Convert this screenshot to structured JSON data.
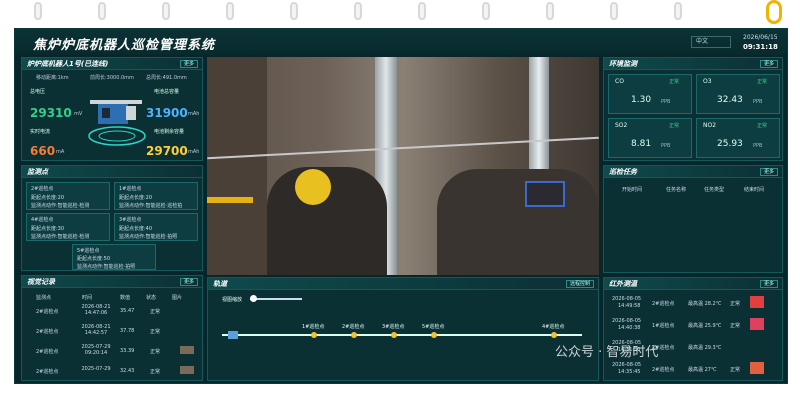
{
  "app": {
    "title": "焦炉炉底机器人巡检管理系统",
    "language": "中文",
    "date": "2026/06/15",
    "time": "09:31:18"
  },
  "robot": {
    "title": "炉炉底机器人1号(已连线)",
    "more": "更多",
    "stats": [
      {
        "label": "移动距离:1km",
        "value": ""
      },
      {
        "label": "前周长:3000.0mm",
        "value": ""
      },
      {
        "label": "总周长:491.0mm",
        "value": ""
      }
    ],
    "voltage_label": "总电压",
    "voltage_value": "29310",
    "voltage_unit": "mV",
    "current_label": "实时电流",
    "current_value": "660",
    "current_unit": "mA",
    "capacity_label": "电池总容量",
    "capacity_value": "31900",
    "capacity_unit": "mAh",
    "remain_label": "电池剩余容量",
    "remain_value": "29700",
    "remain_unit": "mAh"
  },
  "points": {
    "title": "监测点",
    "items": [
      {
        "name": "2#巡检点",
        "line1": "距起点长度:20",
        "line2": "监测点动作:智能巡检·检测"
      },
      {
        "name": "1#巡检点",
        "line1": "距起点长度:20",
        "line2": "监测点动作:智能巡检·巡检拍"
      },
      {
        "name": "4#巡检点",
        "line1": "距起点长度:30",
        "line2": "监测点动作:智能巡检·检测"
      },
      {
        "name": "3#巡检点",
        "line1": "距起点长度:40",
        "line2": "监测点动作:智能巡检·拍照"
      },
      {
        "name": "5#巡检点",
        "line1": "距起点长度:50",
        "line2": "监测点动作:智能巡检·拍照"
      }
    ]
  },
  "report": {
    "title": "视觉记录",
    "more": "更多",
    "headers": [
      "监测点",
      "时间",
      "数值",
      "状态",
      "图片"
    ],
    "rows": [
      {
        "point": "2#巡检点",
        "time": "2026-08-21 14:47:06",
        "value": "35.47",
        "status": "正常"
      },
      {
        "point": "2#巡检点",
        "time": "2026-08-21 14:42:57",
        "value": "37.78",
        "status": "正常"
      },
      {
        "point": "2#巡检点",
        "time": "2025-07-29 09:20:14",
        "value": "33.39",
        "status": "正常"
      },
      {
        "point": "2#巡检点",
        "time": "2025-07-29",
        "value": "32.43",
        "status": "正常"
      }
    ]
  },
  "track": {
    "title": "轨道",
    "more": "远程控制",
    "speed_label": "视图缩放",
    "points": [
      "1#巡检点",
      "2#巡检点",
      "3#巡检点",
      "5#巡检点",
      "4#巡检点"
    ]
  },
  "env": {
    "title": "环境监测",
    "more": "更多",
    "items": [
      {
        "name": "CO",
        "value": "1.30",
        "unit": "PPB",
        "status": "正常"
      },
      {
        "name": "O3",
        "value": "32.43",
        "unit": "PPB",
        "status": "正常"
      },
      {
        "name": "SO2",
        "value": "8.81",
        "unit": "PPB",
        "status": "正常"
      },
      {
        "name": "NO2",
        "value": "25.93",
        "unit": "PPB",
        "status": "正常"
      }
    ]
  },
  "tasks": {
    "title": "巡检任务",
    "more": "更多",
    "headers": [
      "开始时间",
      "任务名称",
      "任务类型",
      "结束时间"
    ]
  },
  "infra": {
    "title": "红外测温",
    "more": "更多",
    "rows": [
      {
        "date": "2026-08-05",
        "time": "14:49:58",
        "point": "2#巡检点",
        "temp": "最高温 28.2℃",
        "status": "正常"
      },
      {
        "date": "2026-08-05",
        "time": "14:40:38",
        "point": "1#巡检点",
        "temp": "最高温 25.9℃",
        "status": "正常"
      },
      {
        "date": "2026-08-05",
        "time": "14:31:50",
        "point": "2#巡检点",
        "temp": "最高温 29.3℃",
        "status": "正常"
      },
      {
        "date": "2026-08-05",
        "time": "14:35:45",
        "point": "2#巡检点",
        "temp": "最高温 27℃",
        "status": "正常"
      }
    ]
  },
  "watermark": "公众号 · 智易时代",
  "colors": {
    "bg": "#08262a",
    "accent": "#33d08c",
    "yellow": "#ffcf3a",
    "blue": "#4fb2ff"
  }
}
